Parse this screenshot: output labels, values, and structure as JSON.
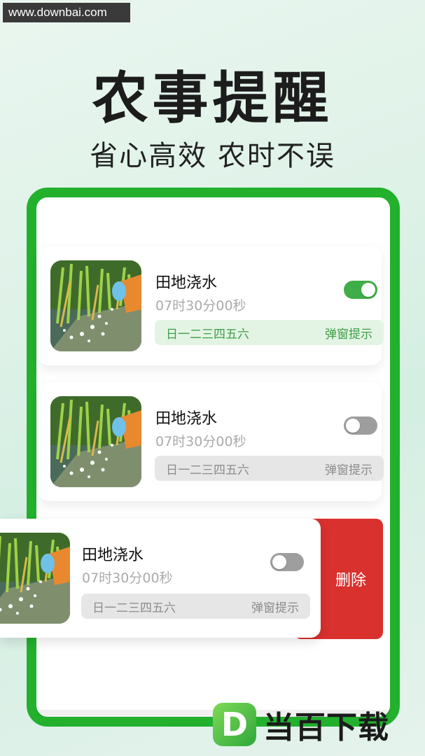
{
  "watermark": "www.downbai.com",
  "hero": {
    "title": "农事提醒",
    "subtitle": "省心高效 农时不误"
  },
  "reminders": [
    {
      "name": "田地浇水",
      "time": "07时30分00秒",
      "days": "日一二三四五六",
      "mode": "弹窗提示",
      "enabled": true,
      "thumb_icon": "watering-field-image"
    },
    {
      "name": "田地浇水",
      "time": "07时30分00秒",
      "days": "日一二三四五六",
      "mode": "弹窗提示",
      "enabled": false,
      "thumb_icon": "watering-field-image"
    },
    {
      "name": "田地浇水",
      "time": "07时30分00秒",
      "days": "日一二三四五六",
      "mode": "弹窗提示",
      "enabled": false,
      "thumb_icon": "watering-field-image"
    }
  ],
  "delete_label": "删除",
  "brand": {
    "logo_letter": "D",
    "name": "当百下载"
  },
  "colors": {
    "accent": "#22b02d",
    "toggle_on": "#3fae48",
    "delete": "#d8312e"
  }
}
